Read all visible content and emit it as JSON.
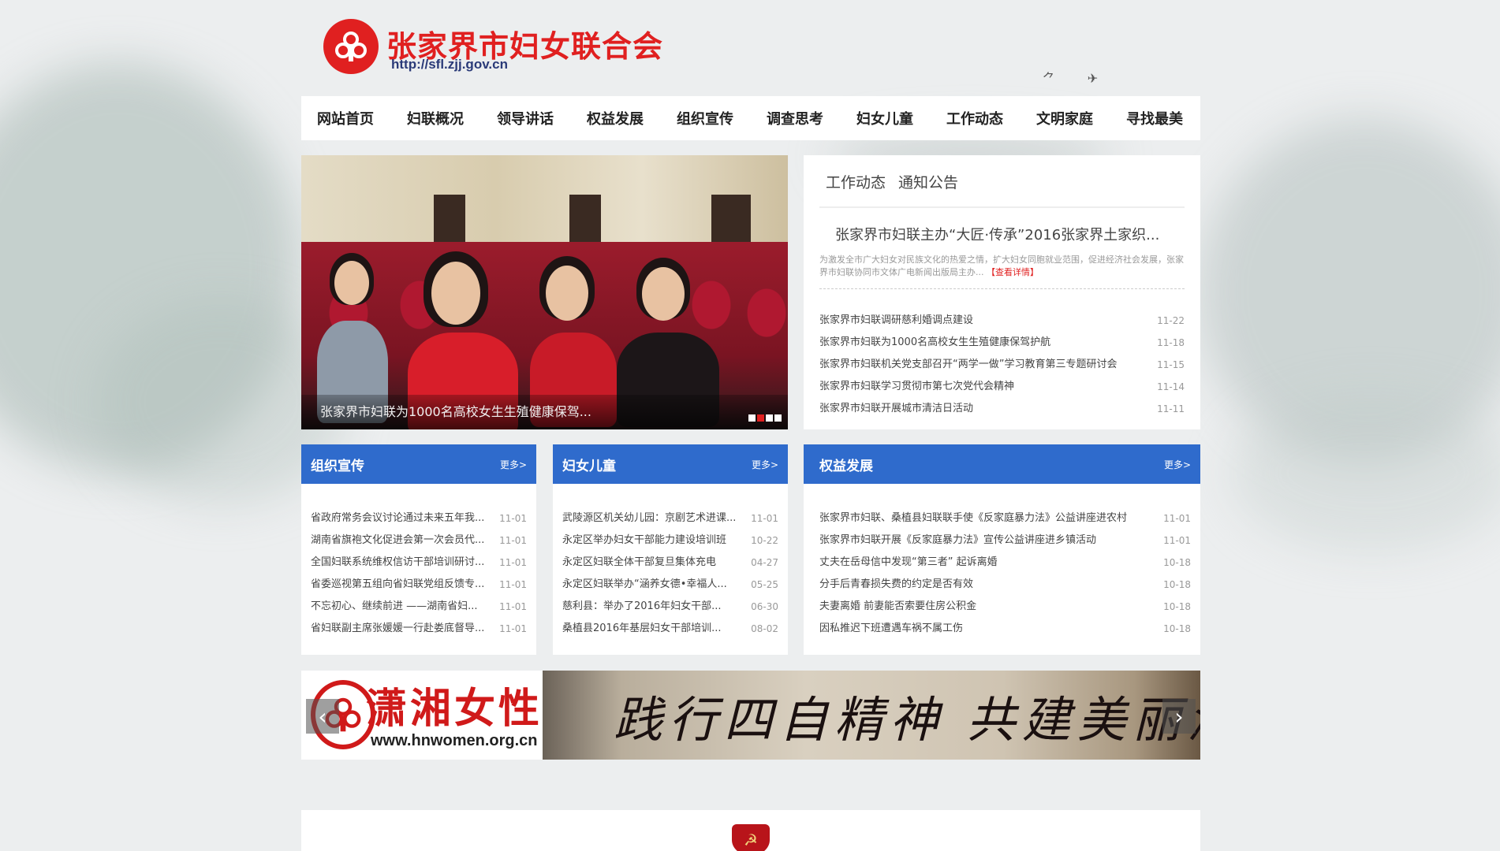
{
  "site": {
    "title": "张家界市妇女联合会",
    "url": "http://sfl.zjj.gov.cn"
  },
  "nav": [
    "网站首页",
    "妇联概况",
    "领导讲话",
    "权益发展",
    "组织宣传",
    "调查思考",
    "妇女儿童",
    "工作动态",
    "文明家庭",
    "寻找最美"
  ],
  "slider": {
    "caption": "张家界市妇联为1000名高校女生生殖健康保驾...",
    "active_dot": 1
  },
  "news": {
    "tabs": [
      "工作动态",
      "通知公告"
    ],
    "headline": "张家界市妇联主办“大匠·传承”2016张家界土家织...",
    "summary": "为激发全市广大妇女对民族文化的热爱之情，扩大妇女同胞就业范围，促进经济社会发展，张家界市妇联协同市文体广电新闻出版局主办...",
    "summary_more": "【查看详情】",
    "items": [
      {
        "title": "张家界市妇联调研慈利婚调点建设",
        "date": "11-22"
      },
      {
        "title": "张家界市妇联为1000名高校女生生殖健康保驾护航",
        "date": "11-18"
      },
      {
        "title": "张家界市妇联机关党支部召开“两学一做”学习教育第三专题研讨会",
        "date": "11-15"
      },
      {
        "title": "张家界市妇联学习贯彻市第七次党代会精神",
        "date": "11-14"
      },
      {
        "title": "张家界市妇联开展城市清洁日活动",
        "date": "11-11"
      }
    ]
  },
  "columns": [
    {
      "title": "组织宣传",
      "more": "更多>",
      "items": [
        {
          "title": "省政府常务会议讨论通过未来五年我...",
          "date": "11-01"
        },
        {
          "title": "湖南省旗袍文化促进会第一次会员代...",
          "date": "11-01"
        },
        {
          "title": "全国妇联系统维权信访干部培训研讨...",
          "date": "11-01"
        },
        {
          "title": "省委巡视第五组向省妇联党组反馈专...",
          "date": "11-01"
        },
        {
          "title": "不忘初心、继续前进 ——湖南省妇...",
          "date": "11-01"
        },
        {
          "title": "省妇联副主席张媛媛一行赴娄底督导...",
          "date": "11-01"
        }
      ]
    },
    {
      "title": "妇女儿童",
      "more": "更多>",
      "items": [
        {
          "title": "武陵源区机关幼儿园：京剧艺术进课...",
          "date": "11-01"
        },
        {
          "title": "永定区举办妇女干部能力建设培训班",
          "date": "10-22"
        },
        {
          "title": "永定区妇联全体干部复旦集体充电",
          "date": "04-27"
        },
        {
          "title": "永定区妇联举办“涵养女德•幸福人...",
          "date": "05-25"
        },
        {
          "title": "慈利县：举办了2016年妇女干部...",
          "date": "06-30"
        },
        {
          "title": "桑植县2016年基层妇女干部培训...",
          "date": "08-02"
        }
      ]
    },
    {
      "title": "权益发展",
      "more": "更多>",
      "items": [
        {
          "title": "张家界市妇联、桑植县妇联联手使《反家庭暴力法》公益讲座进农村",
          "date": "11-01"
        },
        {
          "title": "张家界市妇联开展《反家庭暴力法》宣传公益讲座进乡镇活动",
          "date": "11-01"
        },
        {
          "title": "丈夫在岳母信中发现“第三者” 起诉离婚",
          "date": "10-18"
        },
        {
          "title": "分手后青春损失费的约定是否有效",
          "date": "10-18"
        },
        {
          "title": "夫妻离婚 前妻能否索要住房公积金",
          "date": "10-18"
        },
        {
          "title": "因私推迟下班遭遇车祸不属工伤",
          "date": "10-18"
        }
      ]
    }
  ],
  "banner": {
    "name": "潇湘女性网",
    "url": "www.hnwomen.org.cn",
    "slogan": "践行四自精神 共建美丽湖南",
    "prev": "‹",
    "next": "›"
  },
  "colors": {
    "brand_red": "#e02020",
    "column_blue": "#2f6bcc"
  }
}
